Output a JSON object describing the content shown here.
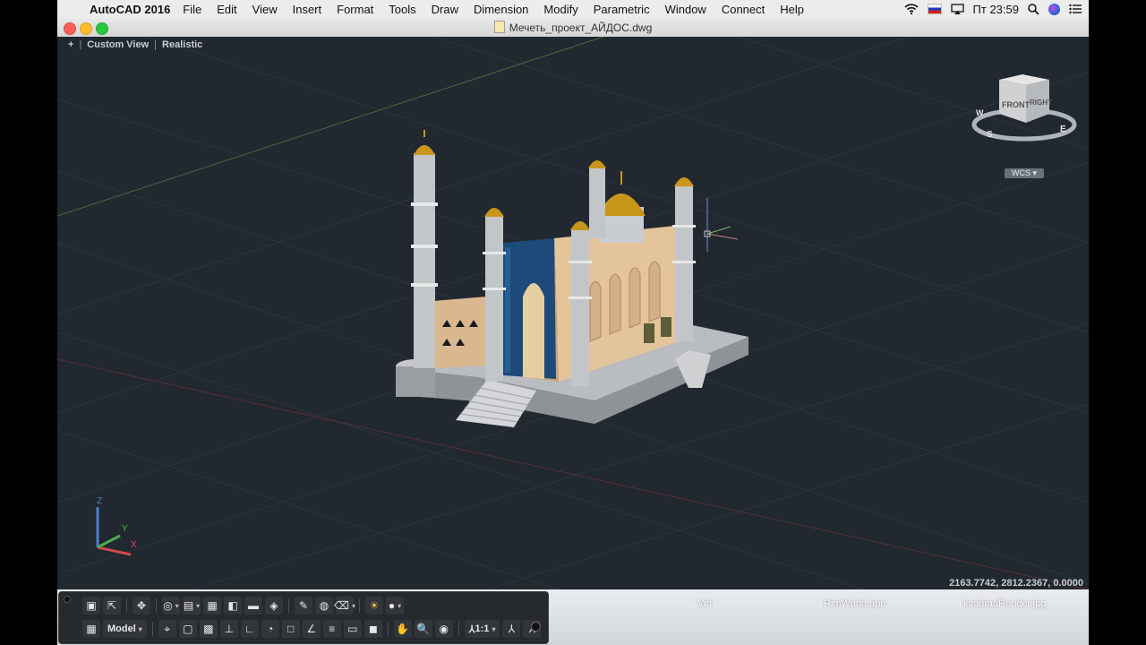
{
  "menubar": {
    "app_name": "AutoCAD 2016",
    "items": [
      "File",
      "Edit",
      "View",
      "Insert",
      "Format",
      "Tools",
      "Draw",
      "Dimension",
      "Modify",
      "Parametric",
      "Window",
      "Connect",
      "Help"
    ],
    "clock": "Пт 23:59"
  },
  "window": {
    "title": "Мечеть_проект_АЙДОС.dwg"
  },
  "viewport": {
    "controls": {
      "minus": "+",
      "view": "Custom View",
      "style": "Realistic"
    },
    "viewcube": {
      "front": "FRONT",
      "right": "RIGHT",
      "compass": [
        "S",
        "E",
        "W"
      ]
    },
    "wcs": "WCS",
    "ucs": {
      "x": "X",
      "y": "Y",
      "z": "Z"
    },
    "coordinates": "2163.7742,  2812.2367, 0.0000"
  },
  "toolbar": {
    "model_label": "Model",
    "scale_label": "1:1"
  },
  "dock": {
    "labels": [
      "Virt",
      "RimWorld.app",
      "kvadradRender.jpg"
    ]
  },
  "colors": {
    "viewport_bg": "#212830",
    "accent_gold": "#c9961c",
    "tile_blue": "#1d4a7a"
  }
}
